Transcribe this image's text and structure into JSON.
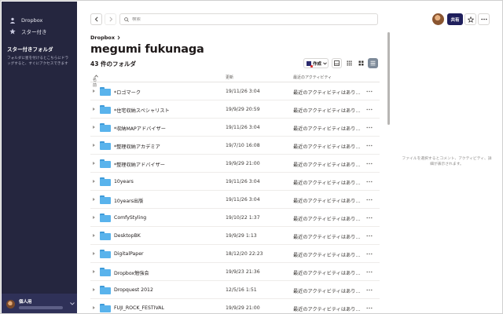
{
  "sidebar": {
    "items": [
      {
        "label": "Dropbox",
        "icon": "user-icon"
      },
      {
        "label": "スター付き",
        "icon": "star-icon"
      }
    ],
    "section_title": "スター付きフォルダ",
    "section_hint": "フォルダに星を付けるとこちらにドラッグすると、すぐにアクセスできます",
    "account": {
      "plan": "個人用"
    }
  },
  "topbar": {
    "search_placeholder": "検索",
    "share_label": "共有"
  },
  "header": {
    "breadcrumb": "Dropbox",
    "title": "megumi fukunaga",
    "folder_count": "43 件のフォルダ",
    "create_label": "作成"
  },
  "table": {
    "columns": {
      "name": "名前",
      "modified": "更新",
      "activity": "最近のアクティビティ"
    },
    "rows": [
      {
        "name": "*ロゴマーク",
        "modified": "19/11/26 3:04",
        "activity": "最近のアクティビティはあり..."
      },
      {
        "name": "*住宅収納スペシャリスト",
        "modified": "19/9/29 20:59",
        "activity": "最近のアクティビティはあり..."
      },
      {
        "name": "*収納MAPアドバイザー",
        "modified": "19/11/26 3:04",
        "activity": "最近のアクティビティはあり..."
      },
      {
        "name": "*整理収納アカデミア",
        "modified": "19/7/10 16:08",
        "activity": "最近のアクティビティはあり..."
      },
      {
        "name": "*整理収納アドバイザー",
        "modified": "19/9/29 21:00",
        "activity": "最近のアクティビティはあり..."
      },
      {
        "name": "10years",
        "modified": "19/11/26 3:04",
        "activity": "最近のアクティビティはあり..."
      },
      {
        "name": "10years出版",
        "modified": "19/11/26 3:04",
        "activity": "最近のアクティビティはあり..."
      },
      {
        "name": "ComfyStyling",
        "modified": "19/10/22 1:37",
        "activity": "最近のアクティビティはあり..."
      },
      {
        "name": "DesktopBK",
        "modified": "19/9/29 1:13",
        "activity": "最近のアクティビティはあり..."
      },
      {
        "name": "DigitalPaper",
        "modified": "18/12/20 22:23",
        "activity": "最近のアクティビティはあり..."
      },
      {
        "name": "Dropbox勉強会",
        "modified": "19/9/23 21:36",
        "activity": "最近のアクティビティはあり..."
      },
      {
        "name": "Dropquest 2012",
        "modified": "12/5/16 1:51",
        "activity": "最近のアクティビティはあり..."
      },
      {
        "name": "FUJI_ROCK_FESTIVAL",
        "modified": "19/9/29 21:00",
        "activity": "最近のアクティビティはあり..."
      }
    ]
  },
  "details_hint": "ファイルを選択するとコメント、アクティビティ、詳細が表示されます。",
  "colors": {
    "sidebar_bg": "#25263f",
    "share_bg": "#1f1f5c",
    "folder_blue": "#59b3ec"
  }
}
